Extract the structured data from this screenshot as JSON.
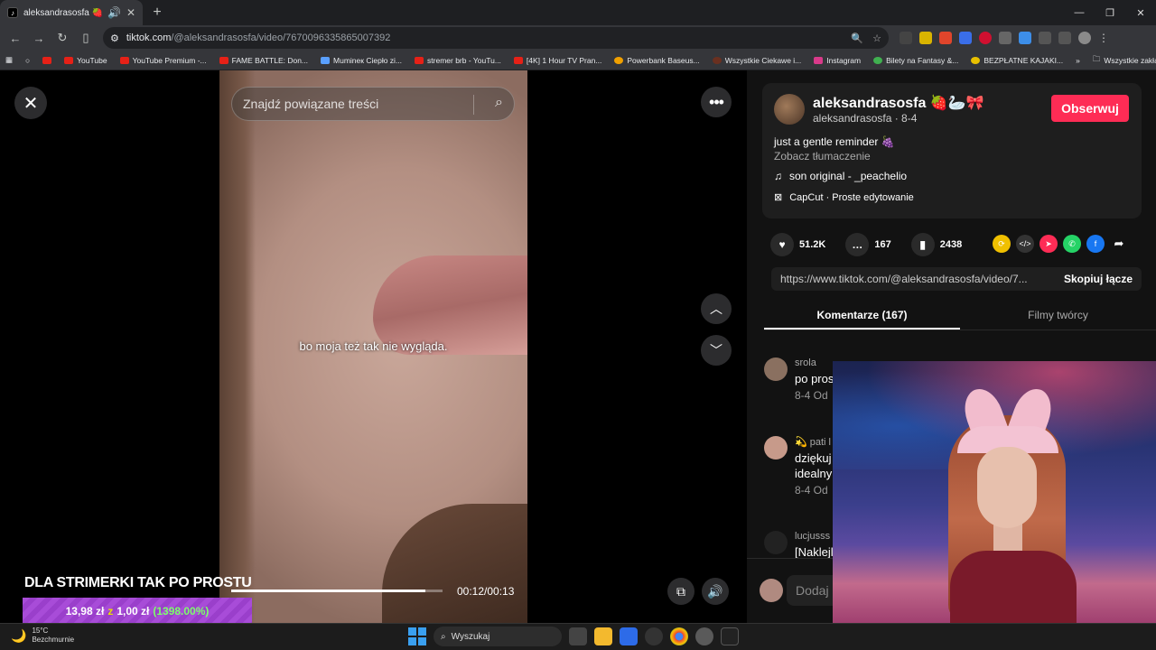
{
  "browser": {
    "tab_title": "aleksandrasosfa 🍓🦢🎀 (",
    "url_site": "tiktok.com",
    "url_path": "/@aleksandrasosfa/video/7670096335865007392",
    "bookmarks": [
      "YouTube",
      "YouTube Premium -...",
      "FAME BATTLE: Don...",
      "Mumineк Ciepło zi...",
      "stremer brb - YouTu...",
      "[4K] 1 Hour TV Pran...",
      "Powerbank Baseus...",
      "Wszystkie Ciekawe i...",
      "Instagram",
      "Bilety na Fantasy &...",
      "BEZPŁATNE KAJAKI..."
    ],
    "bookmarks_all": "Wszystkie zakładki"
  },
  "video": {
    "search_placeholder": "Znajdź powiązane treści",
    "caption": "bo moja też tak nie wygląda.",
    "time": "00:12/00:13",
    "progress": 0.92
  },
  "overlay": {
    "title": "DLA STRIMERKI TAK PO PROSTU",
    "donation_amount": "13,98 zł",
    "donation_z": "z",
    "donation_goal": "1,00 zł",
    "donation_pct": "(1398.00%)"
  },
  "panel": {
    "username": "aleksandrasosfa 🍓🦢🎀",
    "handle_date": "aleksandrasosfa · 8-4",
    "follow_label": "Obserwuj",
    "description": "just a gentle reminder 🍇",
    "translate": "Zobacz tłumaczenie",
    "music": "son original - _peachelio",
    "capcut": "CapCut · Proste edytowanie",
    "likes": "51.2K",
    "comments": "167",
    "saves": "2438",
    "link": "https://www.tiktok.com/@aleksandrasosfa/video/7...",
    "copy_label": "Skopiuj łącze",
    "tab_comments": "Komentarze (167)",
    "tab_creator": "Filmy twórcy",
    "comment_list": [
      {
        "user": "srola",
        "text": "po pros",
        "meta": "8-4   Od"
      },
      {
        "user": "💫 pati l",
        "text": "dziękuj",
        "text2": "idealny",
        "meta": "8-4   Od"
      },
      {
        "user": "lucjusss",
        "text": "[Naklejl",
        "meta": ""
      }
    ],
    "add_comment": "Dodaj"
  },
  "taskbar": {
    "temp": "15°C",
    "weather": "Bezchmurnie",
    "search": "Wyszukaj"
  },
  "colors": {
    "follow": "#fe2c55",
    "donation": "#a84cd8"
  }
}
